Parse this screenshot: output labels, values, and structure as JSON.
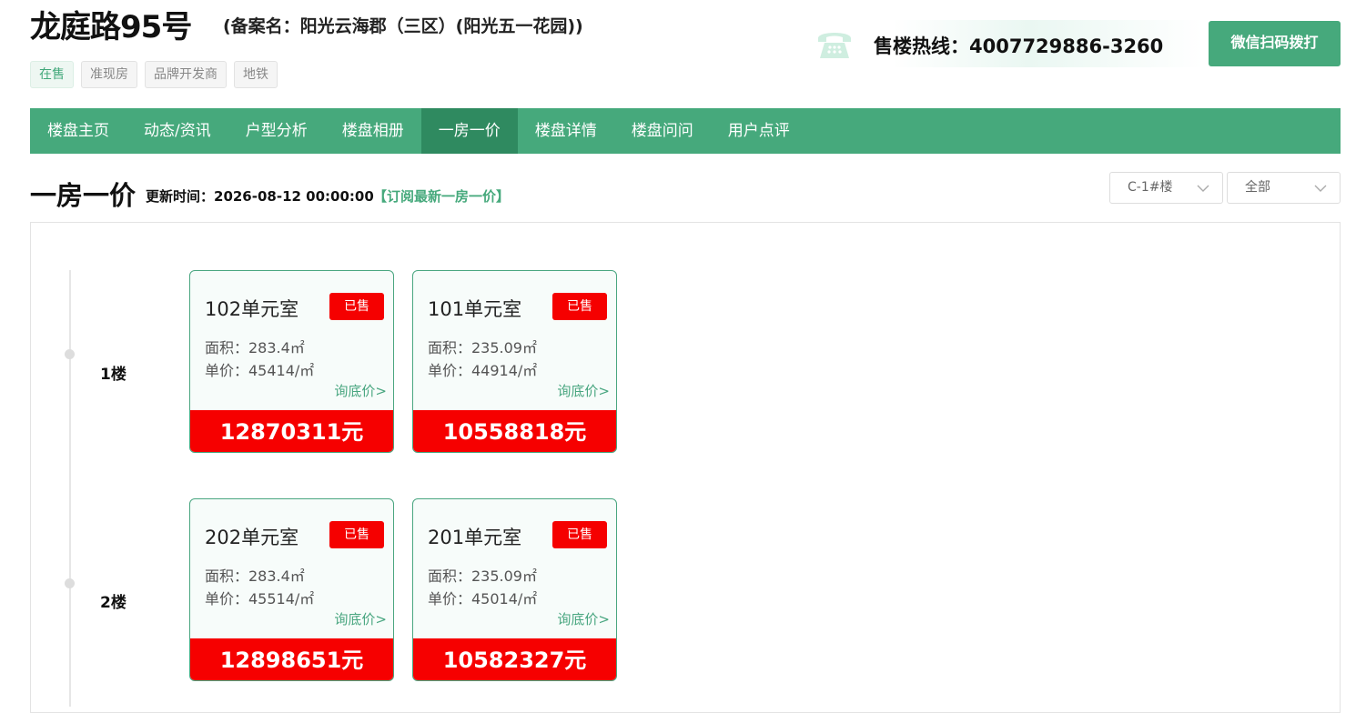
{
  "header": {
    "title": "龙庭路95号",
    "subtitle": "(备案名：阳光云海郡（三区）(阳光五一花园))",
    "tags": [
      "在售",
      "准现房",
      "品牌开发商",
      "地铁"
    ],
    "hotline": "售楼热线：4007729886-3260",
    "wechat_button": "微信扫码拨打",
    "phone_icon": "phone-icon"
  },
  "nav": {
    "items": [
      "楼盘主页",
      "动态/资讯",
      "户型分析",
      "楼盘相册",
      "一房一价",
      "楼盘详情",
      "楼盘问问",
      "用户点评"
    ],
    "active": "一房一价"
  },
  "section": {
    "title": "一房一价",
    "update_time": "更新时间：2026-08-12 00:00:00",
    "subscribe": "【订阅最新一房一价】",
    "building_select": "C-1#楼",
    "status_select": "全部"
  },
  "floors": [
    {
      "label": "1楼",
      "units": [
        {
          "name": "102单元室",
          "status": "已售",
          "area": "面积：283.4㎡",
          "unit_price": "单价：45414/㎡",
          "inquire": "询底价>",
          "price": "12870311元"
        },
        {
          "name": "101单元室",
          "status": "已售",
          "area": "面积：235.09㎡",
          "unit_price": "单价：44914/㎡",
          "inquire": "询底价>",
          "price": "10558818元"
        }
      ]
    },
    {
      "label": "2楼",
      "units": [
        {
          "name": "202单元室",
          "status": "已售",
          "area": "面积：283.4㎡",
          "unit_price": "单价：45514/㎡",
          "inquire": "询底价>",
          "price": "12898651元"
        },
        {
          "name": "201单元室",
          "status": "已售",
          "area": "面积：235.09㎡",
          "unit_price": "单价：45014/㎡",
          "inquire": "询底价>",
          "price": "10582327元"
        }
      ]
    }
  ],
  "colors": {
    "brand_green": "#46a97c",
    "nav_active": "#2f8a60",
    "sold_red": "#f50000"
  }
}
